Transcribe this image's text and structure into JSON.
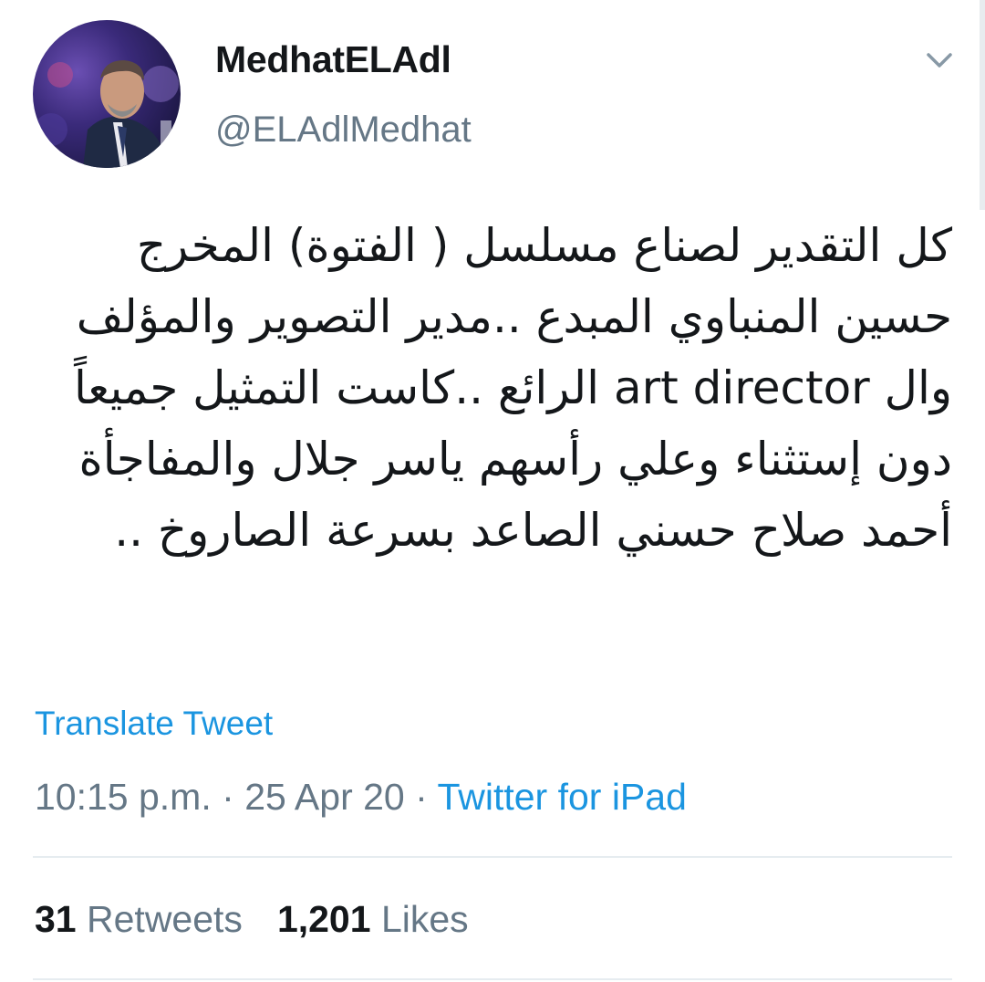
{
  "user": {
    "display_name": "MedhatELAdl",
    "handle": "@ELAdlMedhat",
    "avatar_icon": "profile-photo",
    "menu_icon": "chevron-down-icon"
  },
  "tweet": {
    "text": "كل التقدير لصناع مسلسل ( الفتوة) المخرج حسين المنباوي المبدع ..مدير التصوير والمؤلف وال art director الرائع ..كاست التمثيل جميعاً دون إستثناء وعلي رأسهم ياسر جلال والمفاجأة أحمد صلاح حسني الصاعد بسرعة الصاروخ ..",
    "translate_label": "Translate Tweet",
    "time": "10:15 p.m.",
    "date": "25 Apr 20",
    "separator": "·",
    "source": "Twitter for iPad"
  },
  "stats": {
    "retweets_count": "31",
    "retweets_label": "Retweets",
    "likes_count": "1,201",
    "likes_label": "Likes"
  },
  "colors": {
    "link": "#1b95e0",
    "secondary_text": "#657786",
    "primary_text": "#14171a",
    "divider": "#e6ecf0"
  }
}
